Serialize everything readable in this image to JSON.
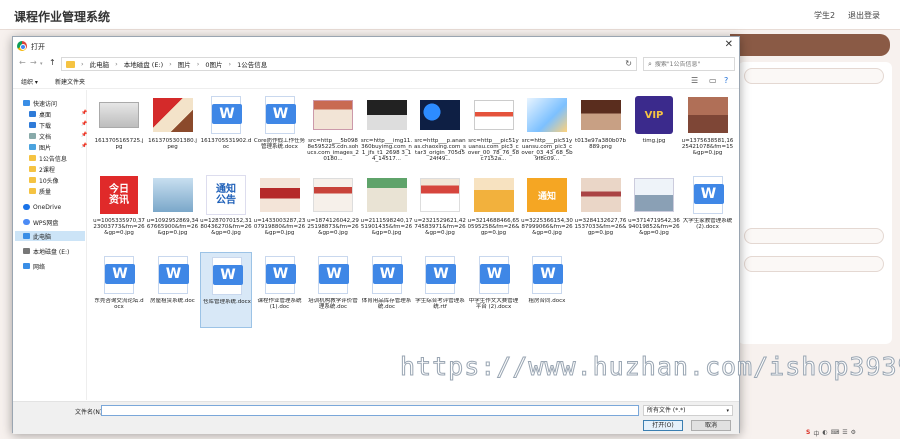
{
  "app": {
    "title": "课程作业管理系统",
    "user": "学生2",
    "logout": "退出登录"
  },
  "watermark": "https://www.huzhan.com/ishop39397",
  "dialog": {
    "title": "打开",
    "breadcrumb": [
      "此电脑",
      "本地磁盘 (E:)",
      "图片",
      "0图片",
      "1公告信息"
    ],
    "search_placeholder": "搜索\"1公告信息\"",
    "organize": "组织 ▾",
    "new_folder": "新建文件夹",
    "sidebar": {
      "quick_access": "快速访问",
      "desktop": "桌面",
      "downloads": "下载",
      "documents": "文档",
      "pictures": "图片",
      "f1": "1公告信息",
      "f2": "2课程",
      "f3": "10头像",
      "f4": "质量",
      "onedrive": "OneDrive",
      "wps": "WPS网盘",
      "this_pc": "此电脑",
      "local_disk": "本地磁盘 (E:)",
      "network": "网络"
    },
    "files": [
      {
        "name": "1613705165725.jpg",
        "thumb": "img-a"
      },
      {
        "name": "1613705301380.jpeg",
        "thumb": "img-b"
      },
      {
        "name": "1613705531902.doc",
        "thumb": "doc"
      },
      {
        "name": "Core防作假工作任务管理系统.docx",
        "thumb": "doc"
      },
      {
        "name": "src=http___5b0988e595225.cdn.sohucs.com_images_20180...",
        "thumb": "img-c"
      },
      {
        "name": "src=http___img11.360buyimg.com_n1_jfs_t1_2698 3_14_14517...",
        "thumb": "img-d"
      },
      {
        "name": "src=http___p.ananas.chaoxing.com_star3_origin_705d524f49...",
        "thumb": "img-e"
      },
      {
        "name": "src=http___pic51yuansu.com_pic3_cover_00_78_76_58c7152a...",
        "thumb": "img-f"
      },
      {
        "name": "src=http___pic51yuansu.com_pic3_cover_03_43_68_5b9f8c09...",
        "thumb": "img-g"
      },
      {
        "name": "t013e97a380b07b889.png",
        "thumb": "img-h"
      },
      {
        "name": "timg.jpg",
        "thumb": "img-vip"
      },
      {
        "name": "u=1375638581,1625421078&fm=15&gp=0.jpg",
        "thumb": "img-i"
      },
      {
        "name": "u=1005335970,3723003773&fm=26&gp=0.jpg",
        "thumb": "img-jr"
      },
      {
        "name": "u=1092952869,3467665900&fm=26&gp=0.jpg",
        "thumb": "img-j"
      },
      {
        "name": "u=1287070152,3180436270&fm=26&gp=0.jpg",
        "thumb": "img-tz"
      },
      {
        "name": "u=1433003287,2307919880&fm=26&gp=0.jpg",
        "thumb": "img-k"
      },
      {
        "name": "u=1874126042,2925198873&fm=26&gp=0.jpg",
        "thumb": "img-l"
      },
      {
        "name": "u=2111598240,1751901435&fm=26&gp=0.jpg",
        "thumb": "img-m"
      },
      {
        "name": "u=2321529621,4274583971&fm=26&gp=0.jpg",
        "thumb": "img-n"
      },
      {
        "name": "u=3214688466,650595258&fm=26&gp=0.jpg",
        "thumb": "img-o"
      },
      {
        "name": "u=3225366154,3087999066&fm=26&gp=0.jpg",
        "thumb": "img-tzo"
      },
      {
        "name": "u=3284132627,761537033&fm=26&gp=0.jpg",
        "thumb": "img-p"
      },
      {
        "name": "u=3714719542,3694019852&fm=26&gp=0.jpg",
        "thumb": "img-q"
      },
      {
        "name": "大学生家教管理系统 (2).docx",
        "thumb": "doc"
      },
      {
        "name": "东莞咨询交流论坛.docx",
        "thumb": "doc"
      },
      {
        "name": "房屋租赁系统.doc",
        "thumb": "doc"
      },
      {
        "name": "仓库管理系统.docx",
        "thumb": "doc",
        "selected": true
      },
      {
        "name": "课程作业管理系统 (1).doc",
        "thumb": "doc"
      },
      {
        "name": "培训机构教学评价管理系统.doc",
        "thumb": "doc"
      },
      {
        "name": "体育用品库存管理系统.doc",
        "thumb": "doc"
      },
      {
        "name": "学生综合考评管理系统.rtf",
        "thumb": "doc"
      },
      {
        "name": "中学生作文大赛管理平台 (2).docx",
        "thumb": "doc"
      },
      {
        "name": "租房合同.docx",
        "thumb": "doc"
      }
    ],
    "filename_label": "文件名(N):",
    "filename_value": "",
    "filetype": "所有文件 (*.*)",
    "open_btn": "打开(O)",
    "cancel_btn": "取消"
  }
}
